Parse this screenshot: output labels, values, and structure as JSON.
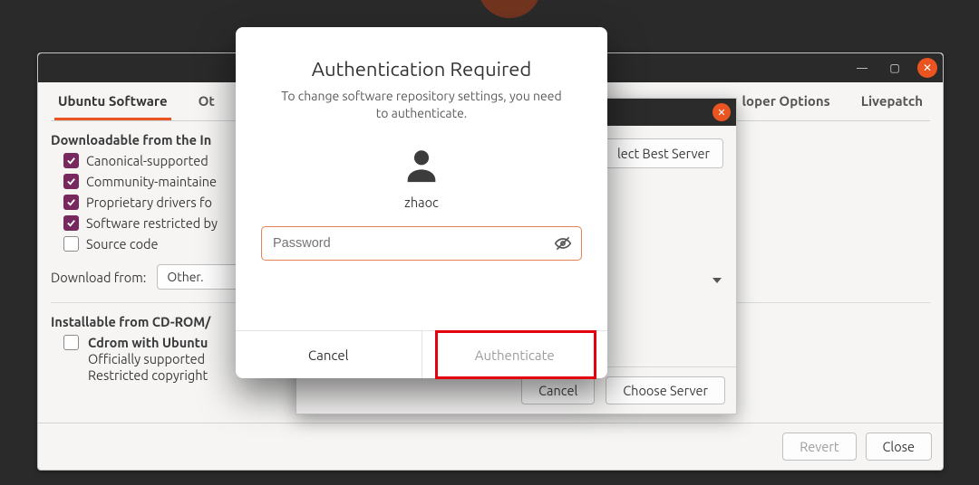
{
  "window": {
    "tabs": {
      "ubuntu_software": "Ubuntu Software",
      "other": "Ot",
      "developer": "loper Options",
      "livepatch": "Livepatch"
    },
    "section_downloadable": "Downloadable from the In",
    "opts": {
      "canonical": "Canonical-supported",
      "community": "Community-maintaine",
      "proprietary": "Proprietary drivers fo",
      "restricted": "Software restricted by",
      "source": "Source code"
    },
    "download_from_label": "Download from:",
    "download_from_value": "Other.",
    "section_installable": "Installable from CD-ROM/",
    "cdrom": {
      "line1": "Cdrom with Ubuntu",
      "line2": "Officially supported",
      "line3": "Restricted copyright"
    },
    "footer": {
      "revert": "Revert",
      "close": "Close"
    },
    "title_icons": {
      "min": "—",
      "max": "▢",
      "close": "✕"
    }
  },
  "subdialog": {
    "select_best": "lect Best Server",
    "protocol_label": "",
    "footer": {
      "cancel": "Cancel",
      "choose": "Choose Server"
    }
  },
  "auth": {
    "title": "Authentication Required",
    "message": "To change software repository settings, you need to authenticate.",
    "username": "zhaoc",
    "password_placeholder": "Password",
    "cancel": "Cancel",
    "authenticate": "Authenticate"
  }
}
